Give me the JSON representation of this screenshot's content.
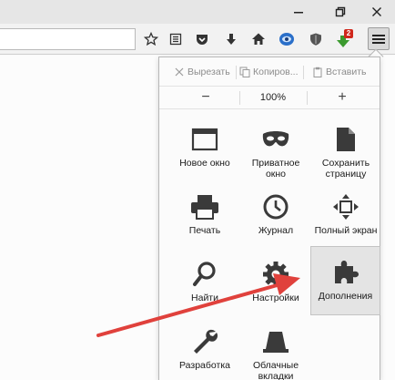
{
  "edit": {
    "cut": "Вырезать",
    "copy": "Копиров...",
    "paste": "Вставить"
  },
  "zoom": {
    "minus": "−",
    "level": "100%",
    "plus": "+"
  },
  "tiles": {
    "new_window": "Новое окно",
    "private_window": "Приватное окно",
    "save_page": "Сохранить страницу",
    "print": "Печать",
    "history": "Журнал",
    "fullscreen": "Полный экран",
    "find": "Найти",
    "options": "Настройки",
    "addons": "Дополнения",
    "developer": "Разработка",
    "cloud_tabs": "Облачные вкладки"
  },
  "toolbar": {
    "notification_badge": "2"
  },
  "colors": {
    "annotation_arrow": "#e0413c",
    "active_tile_bg": "#e4e4e4",
    "badge_red": "#d0281c"
  }
}
